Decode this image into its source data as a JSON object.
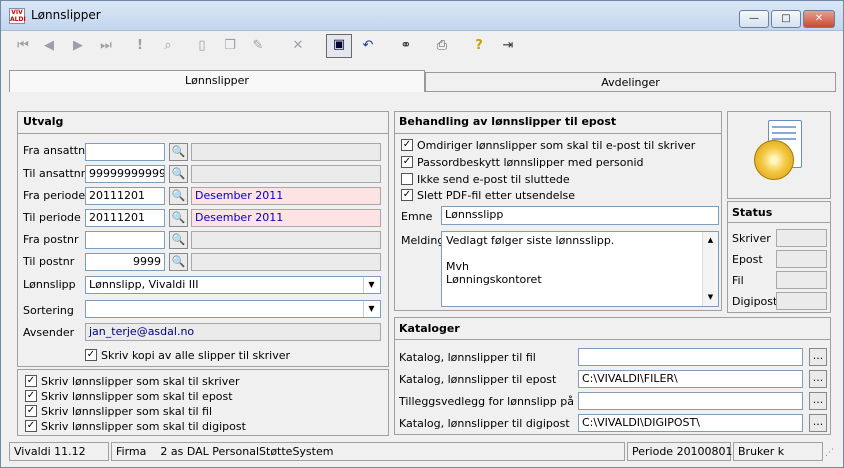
{
  "window": {
    "title": "Lønnslipper",
    "app_icon": "vivaldi-app-icon",
    "min_label": "—",
    "max_label": "□",
    "close_label": "✕"
  },
  "toolbar": {
    "buttons": [
      {
        "name": "first-record-icon",
        "glyph": "⏮"
      },
      {
        "name": "prev-record-icon",
        "glyph": "◀"
      },
      {
        "name": "next-record-icon",
        "glyph": "▶"
      },
      {
        "name": "last-record-icon",
        "glyph": "⏭"
      },
      {
        "name": "exclamation-icon",
        "glyph": "!"
      },
      {
        "name": "search-doc-icon",
        "glyph": "🔍"
      },
      {
        "name": "new-doc-icon",
        "glyph": "🗋"
      },
      {
        "name": "copy-icon",
        "glyph": "❐"
      },
      {
        "name": "edit-icon",
        "glyph": "✎"
      },
      {
        "name": "delete-icon",
        "glyph": "✕"
      },
      {
        "name": "save-icon",
        "glyph": "💾"
      },
      {
        "name": "undo-icon",
        "glyph": "↶"
      },
      {
        "name": "binoculars-icon",
        "glyph": "🔭"
      },
      {
        "name": "print-icon",
        "glyph": "🖶"
      },
      {
        "name": "help-icon",
        "glyph": "?"
      },
      {
        "name": "exit-icon",
        "glyph": "⇥"
      }
    ]
  },
  "tabs": [
    {
      "label": "Lønnslipper",
      "active": true
    },
    {
      "label": "Avdelinger",
      "active": false
    }
  ],
  "utvalg": {
    "title": "Utvalg",
    "fields": {
      "fra_ansattnr": {
        "label": "Fra ansattnr",
        "value": ""
      },
      "til_ansattnr": {
        "label": "Til ansattnr",
        "value": "99999999999"
      },
      "fra_periode": {
        "label": "Fra periode",
        "value": "20111201",
        "desc": "Desember 2011"
      },
      "til_periode": {
        "label": "Til periode",
        "value": "20111201",
        "desc": "Desember 2011"
      },
      "fra_postnr": {
        "label": "Fra postnr",
        "value": ""
      },
      "til_postnr": {
        "label": "Til postnr",
        "value": "9999"
      },
      "lonnslipp": {
        "label": "Lønnslipp",
        "value": "Lønnslipp, Vivaldi  III"
      },
      "sortering": {
        "label": "Sortering",
        "value": ""
      },
      "avsender": {
        "label": "Avsender",
        "value": "jan_terje@asdal.no"
      }
    },
    "kopi_checkbox": {
      "label": "Skriv kopi av alle slipper til skriver",
      "checked": true
    }
  },
  "skriv_options": [
    {
      "label": "Skriv lønnslipper som skal til skriver",
      "checked": true
    },
    {
      "label": "Skriv lønnslipper som skal til epost",
      "checked": true
    },
    {
      "label": "Skriv lønnslipper som skal til fil",
      "checked": true
    },
    {
      "label": "Skriv lønnslipper som skal til digipost",
      "checked": true
    }
  ],
  "behandling": {
    "title": "Behandling av lønnslipper til epost",
    "options": [
      {
        "label": "Omdiriger lønnslipper som skal til e-post til skriver",
        "checked": true
      },
      {
        "label": "Passordbeskytt lønnslipper med personid",
        "checked": true
      },
      {
        "label": "Ikke send e-post til sluttede",
        "checked": false
      },
      {
        "label": "Slett PDF-fil etter utsendelse",
        "checked": true
      }
    ],
    "emne_label": "Emne",
    "emne_value": "Lønnsslipp",
    "melding_label": "Melding",
    "melding_lines": [
      "Vedlagt følger siste lønnsslipp.",
      "",
      "Mvh",
      "Lønningskontoret"
    ]
  },
  "status_panel": {
    "title": "Status",
    "rows": [
      {
        "label": "Skriver",
        "value": ""
      },
      {
        "label": "Epost",
        "value": ""
      },
      {
        "label": "Fil",
        "value": ""
      },
      {
        "label": "Digipost",
        "value": ""
      }
    ]
  },
  "kataloger": {
    "title": "Kataloger",
    "rows": [
      {
        "label": "Katalog, lønnslipper til fil",
        "value": ""
      },
      {
        "label": "Katalog, lønnslipper til epost",
        "value": "C:\\VIVALDI\\FILER\\"
      },
      {
        "label": "Tilleggsvedlegg for lønnslipp på epost",
        "value": ""
      },
      {
        "label": "Katalog, lønnslipper til digipost",
        "value": "C:\\VIVALDI\\DIGIPOST\\"
      }
    ],
    "browse_label": "..."
  },
  "statusbar": {
    "version": "Vivaldi  11.12",
    "firma_label": "Firma",
    "firma_value": "2 as DAL PersonalStøtteSystem",
    "periode": "Periode 20100801",
    "bruker": "Bruker k"
  },
  "colors": {
    "pink_field": "#fde3e3",
    "desc_text": "#0000cc",
    "window_bg": "#f0f0f0"
  }
}
